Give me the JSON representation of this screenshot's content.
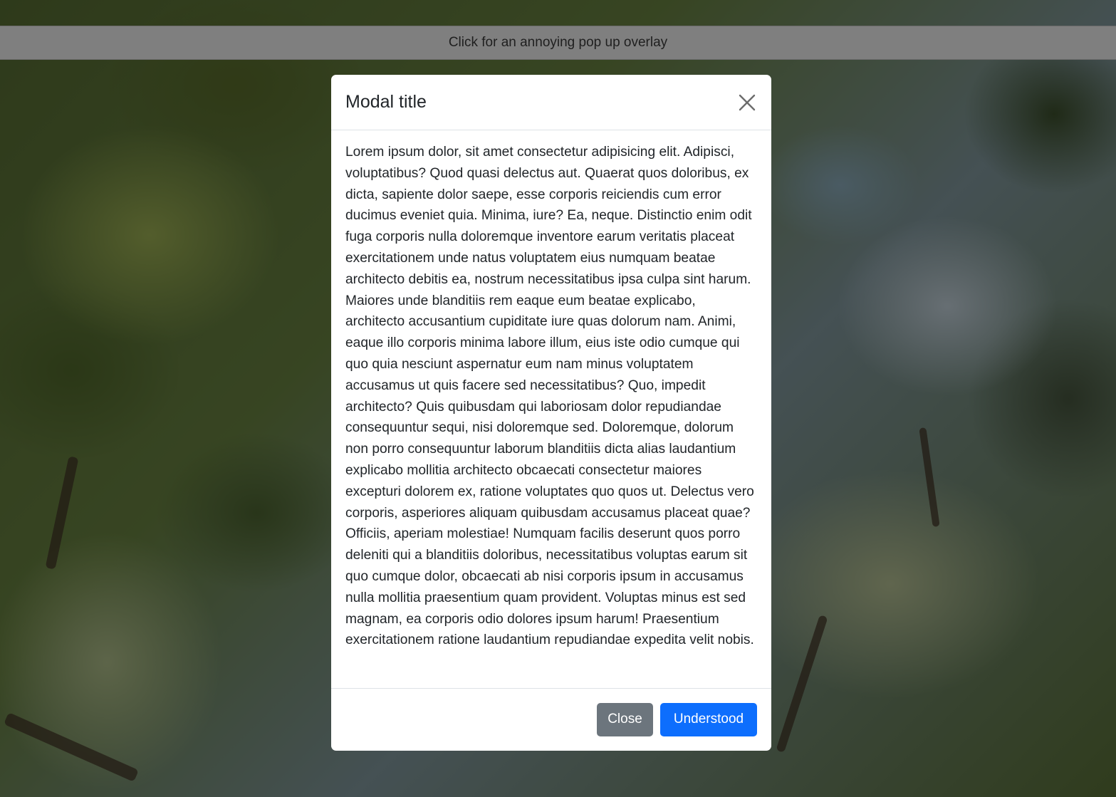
{
  "background": {
    "description_icon": "blurred-foliage-photo"
  },
  "topbar": {
    "label": "Click for an annoying pop up overlay"
  },
  "modal": {
    "title": "Modal title",
    "close_icon": "close-icon",
    "body": "Lorem ipsum dolor, sit amet consectetur adipisicing elit. Adipisci, voluptatibus? Quod quasi delectus aut. Quaerat quos doloribus, ex dicta, sapiente dolor saepe, esse corporis reiciendis cum error ducimus eveniet quia. Minima, iure? Ea, neque. Distinctio enim odit fuga corporis nulla doloremque inventore earum veritatis placeat exercitationem unde natus voluptatem eius numquam beatae architecto debitis ea, nostrum necessitatibus ipsa culpa sint harum. Maiores unde blanditiis rem eaque eum beatae explicabo, architecto accusantium cupiditate iure quas dolorum nam. Animi, eaque illo corporis minima labore illum, eius iste odio cumque qui quo quia nesciunt aspernatur eum nam minus voluptatem accusamus ut quis facere sed necessitatibus? Quo, impedit architecto? Quis quibusdam qui laboriosam dolor repudiandae consequuntur sequi, nisi doloremque sed. Doloremque, dolorum non porro consequuntur laborum blanditiis dicta alias laudantium explicabo mollitia architecto obcaecati consectetur maiores excepturi dolorem ex, ratione voluptates quo quos ut. Delectus vero corporis, asperiores aliquam quibusdam accusamus placeat quae? Officiis, aperiam molestiae! Numquam facilis deserunt quos porro deleniti qui a blanditiis doloribus, necessitatibus voluptas earum sit quo cumque dolor, obcaecati ab nisi corporis ipsum in accusamus nulla mollitia praesentium quam provident. Voluptas minus est sed magnam, ea corporis odio dolores ipsum harum! Praesentium exercitationem ratione laudantium repudiandae expedita velit nobis.",
    "close_button": "Close",
    "primary_button": "Understood"
  },
  "colors": {
    "primary": "#0d6efd",
    "secondary": "#6c757d",
    "backdrop": "rgba(0,0,0,0.5)"
  }
}
